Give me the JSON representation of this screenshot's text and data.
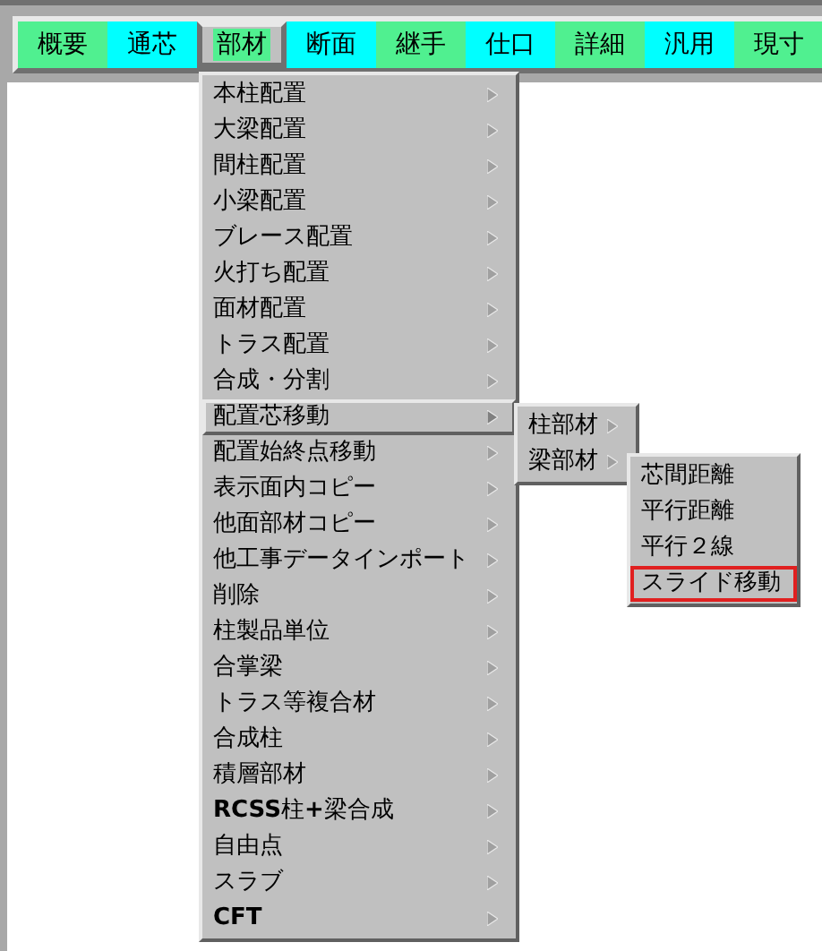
{
  "tabs": [
    {
      "label": "概要",
      "color": "#50f090",
      "selected": false
    },
    {
      "label": "通芯",
      "color": "#00ffff",
      "selected": false
    },
    {
      "label": "部材",
      "color": "#50f090",
      "selected": true
    },
    {
      "label": "断面",
      "color": "#00ffff",
      "selected": false
    },
    {
      "label": "継手",
      "color": "#50f090",
      "selected": false
    },
    {
      "label": "仕口",
      "color": "#00ffff",
      "selected": false
    },
    {
      "label": "詳細",
      "color": "#50f090",
      "selected": false
    },
    {
      "label": "汎用",
      "color": "#00ffff",
      "selected": false
    },
    {
      "label": "現寸",
      "color": "#50f090",
      "selected": false
    }
  ],
  "menu": {
    "items": [
      {
        "label": "本柱配置",
        "selected": false
      },
      {
        "label": "大梁配置",
        "selected": false
      },
      {
        "label": "間柱配置",
        "selected": false
      },
      {
        "label": "小梁配置",
        "selected": false
      },
      {
        "label": "ブレース配置",
        "selected": false
      },
      {
        "label": "火打ち配置",
        "selected": false
      },
      {
        "label": "面材配置",
        "selected": false
      },
      {
        "label": "トラス配置",
        "selected": false
      },
      {
        "label": "合成・分割",
        "selected": false
      },
      {
        "label": "配置芯移動",
        "selected": true
      },
      {
        "label": "配置始終点移動",
        "selected": false
      },
      {
        "label": "表示面内コピー",
        "selected": false
      },
      {
        "label": "他面部材コピー",
        "selected": false
      },
      {
        "label": "他工事データインポート",
        "selected": false
      },
      {
        "label": "削除",
        "selected": false
      },
      {
        "label": "柱製品単位",
        "selected": false
      },
      {
        "label": "合掌梁",
        "selected": false
      },
      {
        "label": "トラス等複合材",
        "selected": false
      },
      {
        "label": "合成柱",
        "selected": false
      },
      {
        "label": "積層部材",
        "selected": false
      },
      {
        "label": "**RCSS**柱**+**梁合成",
        "selected": false
      },
      {
        "label": "自由点",
        "selected": false
      },
      {
        "label": "スラブ",
        "selected": false
      },
      {
        "label": "**CFT**",
        "selected": false
      }
    ]
  },
  "submenu": {
    "items": [
      {
        "label": "柱部材",
        "selected": false
      },
      {
        "label": "梁部材",
        "selected": false
      }
    ]
  },
  "submenu_2": {
    "items": [
      {
        "label": "芯間距離",
        "highlighted": false
      },
      {
        "label": "平行距離",
        "highlighted": false
      },
      {
        "label": "平行２線",
        "highlighted": false
      },
      {
        "label": "スライド移動",
        "highlighted": true
      }
    ]
  }
}
